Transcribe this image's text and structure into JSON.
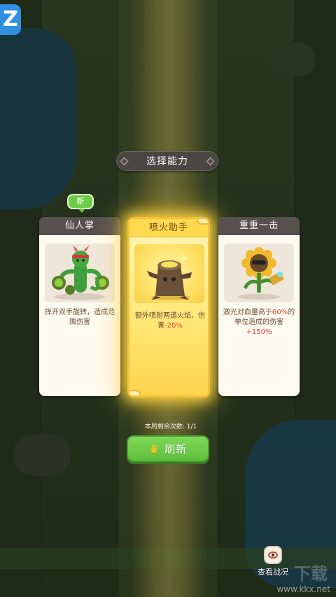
{
  "logo_text": "Z",
  "title": "选择能力",
  "new_badge": "新",
  "cards": [
    {
      "name": "仙人掌",
      "desc_parts": [
        "挥开双手旋转，造成范围伤害"
      ],
      "portrait": "cactus-fighter-icon"
    },
    {
      "name": "喷火助手",
      "desc_pre": "额外喷射两道火焰，伤害",
      "desc_highlight": "-20%",
      "portrait": "tree-stump-icon",
      "selected": true
    },
    {
      "name": "重重一击",
      "desc_pre": "激光对血量高于",
      "desc_hl1": "60%",
      "desc_mid": "的单位造成的伤害",
      "desc_hl2": "+150%",
      "portrait": "sunflower-laser-icon"
    }
  ],
  "remaining_label": "本局剩余次数:",
  "remaining_value": "1/1",
  "refresh_label": "刷新",
  "view_battle_label": "查看战况",
  "watermark_small": "www.kkx.net",
  "watermark_big": "下载",
  "colors": {
    "highlight": "#e4442f",
    "card_header": "#56504e",
    "selected_glow": "#ffd94e",
    "button_green": "#6ccb47"
  }
}
